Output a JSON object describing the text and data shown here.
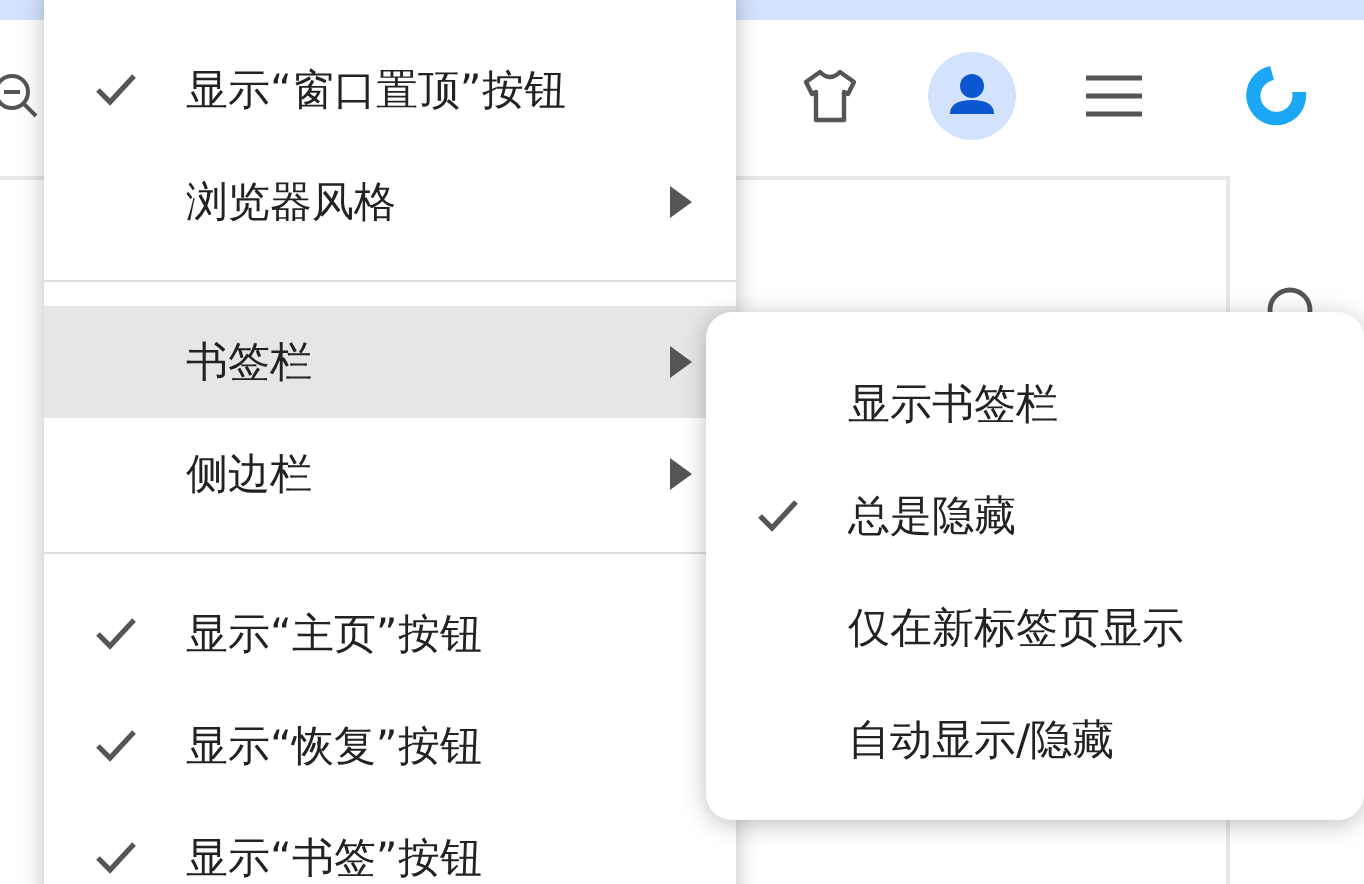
{
  "menu": {
    "items": [
      {
        "kind": "check",
        "label": "显示“窗口置顶”按钮",
        "checked": true
      },
      {
        "kind": "submenu",
        "label": "浏览器风格",
        "selected": false
      },
      {
        "kind": "divider"
      },
      {
        "kind": "submenu",
        "label": "书签栏",
        "selected": true
      },
      {
        "kind": "submenu",
        "label": "侧边栏",
        "selected": false
      },
      {
        "kind": "divider"
      },
      {
        "kind": "check",
        "label": "显示“主页”按钮",
        "checked": true
      },
      {
        "kind": "check",
        "label": "显示“恢复”按钮",
        "checked": true
      },
      {
        "kind": "check",
        "label": "显示“书签”按钮",
        "checked": true
      }
    ]
  },
  "submenu": {
    "items": [
      {
        "label": "显示书签栏",
        "checked": false
      },
      {
        "label": "总是隐藏",
        "checked": true
      },
      {
        "label": "仅在新标签页显示",
        "checked": false
      },
      {
        "label": "自动显示/隐藏",
        "checked": false
      }
    ]
  }
}
